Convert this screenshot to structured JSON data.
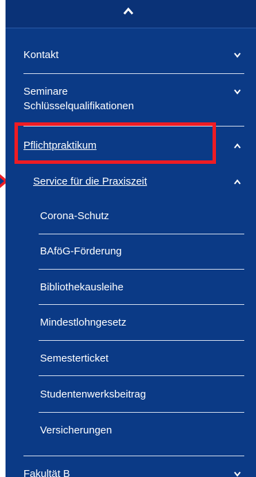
{
  "colors": {
    "panel_bg": "#0b3a86",
    "text": "#ffffff",
    "highlight": "#ee1c24"
  },
  "nav": {
    "top_toggle_icon": "chevron-up-icon",
    "items": [
      {
        "label": "Kontakt",
        "icon": "chevron-down-icon"
      },
      {
        "label": "Seminare Schlüsselqualifikationen",
        "line1": "Seminare",
        "line2": "Schlüsselqualifikationen",
        "icon": "chevron-down-icon"
      },
      {
        "label": "Pflichtpraktikum",
        "icon": "chevron-up-icon",
        "highlighted": true
      },
      {
        "label": "Service für die Praxiszeit",
        "icon": "chevron-up-icon"
      }
    ],
    "subitems": [
      "Corona-Schutz",
      "BAföG-Förderung",
      "Bibliothekausleihe",
      "Mindestlohngesetz",
      "Semesterticket",
      "Studentenwerksbeitrag",
      "Versicherungen"
    ],
    "bottom_item": {
      "label": "Fakultät B",
      "icon": "chevron-down-icon"
    }
  }
}
